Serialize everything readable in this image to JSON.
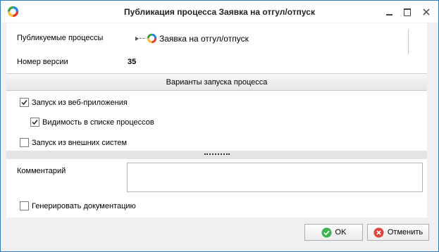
{
  "window": {
    "title": "Публикация процесса Заявка на отгул/отпуск",
    "app_icon": "app-ring-logo-icon"
  },
  "form": {
    "published_label": "Публикуемые процессы",
    "process_name": "Заявка на отгул/отпуск",
    "version_label": "Номер версии",
    "version_value": "35",
    "section_title": "Варианты запуска процесса",
    "options": [
      {
        "label": "Запуск из веб-приложения",
        "checked": true
      },
      {
        "label": "Видимость в списке процессов",
        "checked": true
      },
      {
        "label": "Запуск из внешних систем",
        "checked": false
      }
    ],
    "comment_label": "Комментарий",
    "comment_value": "",
    "generate_doc_label": "Генерировать документацию",
    "generate_doc_checked": false
  },
  "buttons": {
    "ok_label": "OK",
    "cancel_label": "Отменить"
  },
  "colors": {
    "ok_green": "#3fb34f",
    "cancel_red": "#e0453a",
    "border_blue": "#2f7bc4"
  }
}
